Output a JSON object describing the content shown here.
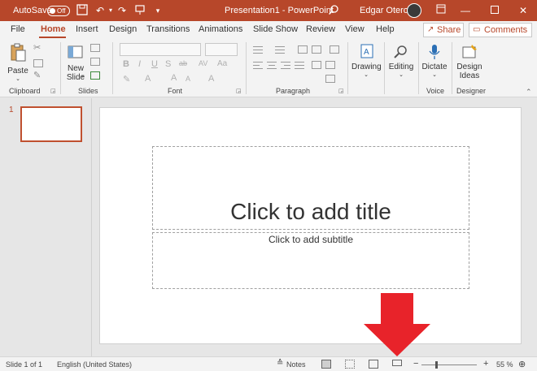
{
  "titlebar": {
    "autosave_label": "AutoSave",
    "autosave_state": "Off",
    "doc_title": "Presentation1 - PowerPoint",
    "user_name": "Edgar Otero",
    "icons": [
      "save-icon",
      "undo-icon",
      "redo-icon",
      "present-icon",
      "customize-qat-icon",
      "search-icon",
      "ribbon-display-icon",
      "minimize-icon",
      "maximize-icon",
      "close-icon"
    ]
  },
  "tabs": [
    "File",
    "Home",
    "Insert",
    "Design",
    "Transitions",
    "Animations",
    "Slide Show",
    "Review",
    "View",
    "Help"
  ],
  "actions": {
    "share": "Share",
    "comments": "Comments"
  },
  "ribbon": {
    "paste": "Paste",
    "new_slide_line1": "New",
    "new_slide_line2": "Slide",
    "drawing": "Drawing",
    "editing": "Editing",
    "dictate": "Dictate",
    "design_ideas_line1": "Design",
    "design_ideas_line2": "Ideas",
    "groups": {
      "clipboard": "Clipboard",
      "slides": "Slides",
      "font": "Font",
      "paragraph": "Paragraph",
      "voice": "Voice",
      "designer": "Designer"
    },
    "font_buttons": [
      "B",
      "I",
      "U",
      "S",
      "ab",
      "AV",
      "Aa"
    ]
  },
  "thumbnail": {
    "number": "1"
  },
  "slide": {
    "title_placeholder": "Click to add title",
    "subtitle_placeholder": "Click to add subtitle"
  },
  "statusbar": {
    "slide_info": "Slide 1 of 1",
    "language": "English (United States)",
    "notes": "Notes",
    "zoom_out": "−",
    "zoom_in": "+",
    "zoom": "55 %"
  },
  "colors": {
    "accent": "#b7472a",
    "annotation_arrow": "#e8232a"
  }
}
